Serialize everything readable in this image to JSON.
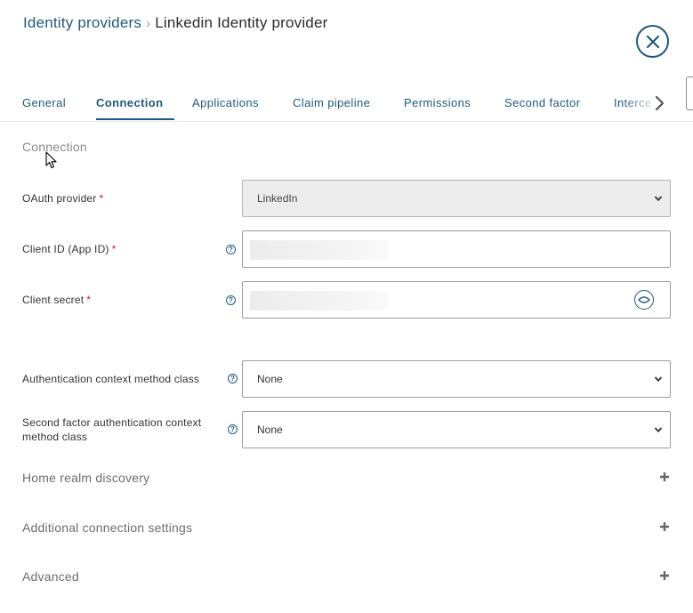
{
  "breadcrumb": {
    "parent": "Identity providers",
    "separator": "›",
    "current": "Linkedin Identity provider"
  },
  "tabs": [
    {
      "label": "General",
      "active": false
    },
    {
      "label": "Connection",
      "active": true
    },
    {
      "label": "Applications",
      "active": false
    },
    {
      "label": "Claim pipeline",
      "active": false
    },
    {
      "label": "Permissions",
      "active": false
    },
    {
      "label": "Second factor",
      "active": false
    },
    {
      "label": "Interce",
      "active": false
    }
  ],
  "section": {
    "title": "Connection"
  },
  "fields": {
    "oauth_provider": {
      "label": "OAuth provider",
      "required": "*",
      "value": "LinkedIn"
    },
    "client_id": {
      "label": "Client ID (App ID)",
      "required": "*",
      "help": "?"
    },
    "client_secret": {
      "label": "Client secret",
      "required": "*",
      "help": "?"
    },
    "auth_context": {
      "label": "Authentication context method class",
      "help": "?",
      "value": "None"
    },
    "second_factor_context": {
      "label": "Second factor authentication context method class",
      "help": "?",
      "value": "None"
    }
  },
  "collapsibles": {
    "home_realm": "Home realm discovery",
    "additional": "Additional connection settings",
    "advanced": "Advanced"
  },
  "colors": {
    "accent": "#1f5a7e",
    "required": "#c62828"
  },
  "icons": {
    "close": "close-icon",
    "next": "chevron-right-icon",
    "help": "help-icon",
    "eye": "eye-icon",
    "dropdown": "chevron-down-icon",
    "expand": "plus-icon"
  }
}
